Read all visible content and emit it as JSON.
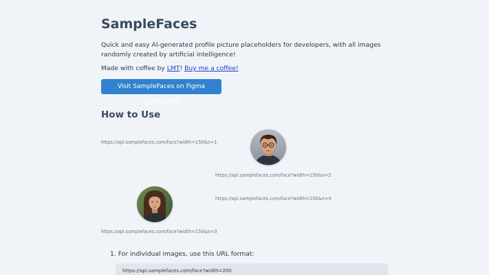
{
  "header": {
    "title": "SampleFaces",
    "intro": "Quick and easy AI-generated profile picture placeholders for developers, with all images randomly created by artificial intelligence!",
    "credit_prefix": "Made with coffee by ",
    "credit_author": "LMT",
    "credit_separator": "! ",
    "credit_coffee": "Buy me a coffee!",
    "figma_button": "Visit SampleFaces on Figma Community"
  },
  "how_to_use": {
    "title": "How to Use",
    "examples": [
      {
        "caption": "https://api.samplefaces.com/face?width=150&n=1",
        "has_image": false,
        "icon": "broken-image"
      },
      {
        "caption": "https://api.samplefaces.com/face?width=150&n=2",
        "has_image": true,
        "icon": "face-avatar-man"
      },
      {
        "caption": "https://api.samplefaces.com/face?width=150&n=3",
        "has_image": true,
        "icon": "face-avatar-woman"
      },
      {
        "caption": "https://api.samplefaces.com/face?width=150&n=4",
        "has_image": false,
        "icon": "broken-image"
      }
    ],
    "steps": [
      {
        "number": "1.",
        "text": "For individual images, use this URL format:"
      }
    ],
    "code_example": "https://api.samplefaces.com/face?width=200"
  },
  "colors": {
    "background": "#f0f4f8",
    "accent": "#3182ce",
    "link": "#1a3fc8",
    "heading": "#3a4a5e"
  }
}
